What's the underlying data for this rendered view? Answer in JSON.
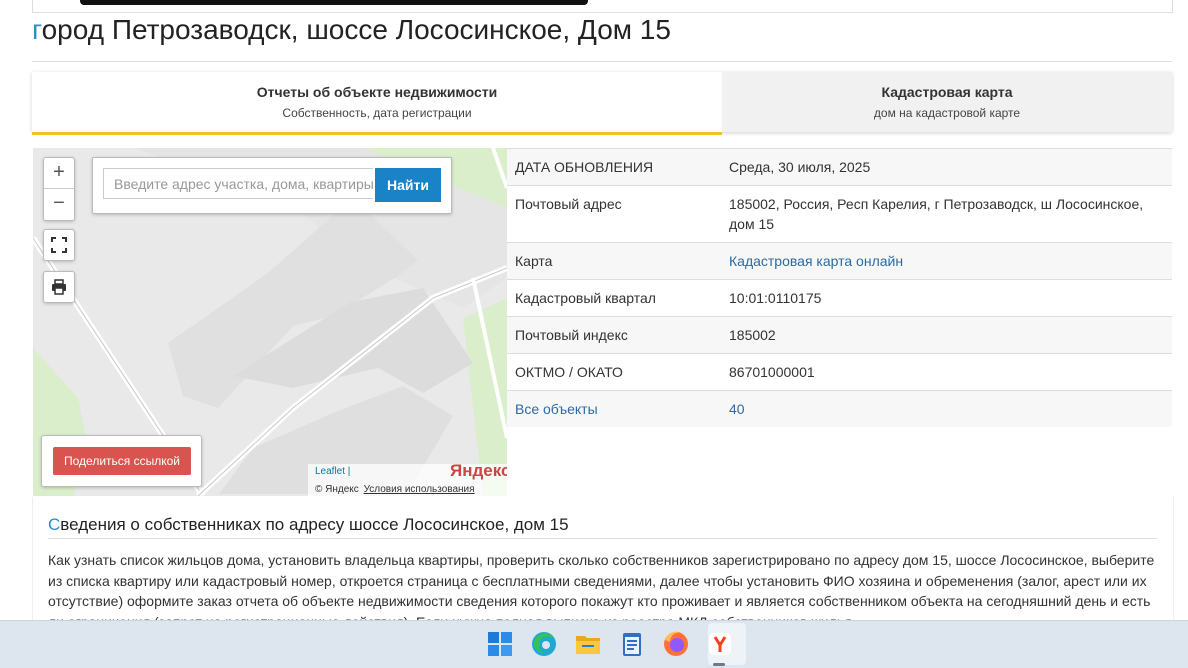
{
  "page": {
    "title_first_letter": "г",
    "title_rest": "ород Петрозаводск, шоссе Лососинское, Дом 15"
  },
  "tabs": [
    {
      "title": "Отчеты об объекте недвижимости",
      "subtitle": "Собственность, дата регистрации"
    },
    {
      "title": "Кадастровая карта",
      "subtitle": "дом на кадастровой карте"
    }
  ],
  "map": {
    "zoom_in": "+",
    "zoom_out": "−",
    "search_placeholder": "Введите адрес участка, дома, квартиры",
    "search_button": "Найти",
    "share_button": "Поделиться ссылкой",
    "attribution_leaflet": "Leaflet |",
    "attribution_yandex": "© Яндекс",
    "terms_link": "Условия использования",
    "yandex_logo": "Яндекс",
    "icons": [
      "fullscreen-icon",
      "print-icon"
    ]
  },
  "info_rows": [
    {
      "label": "ДАТА ОБНОВЛЕНИЯ",
      "value": "Среда, 30 июля, 2025"
    },
    {
      "label": "Почтовый адрес",
      "value": "185002, Россия, Респ Карелия, г Петрозаводск, ш Лососинское, дом 15"
    },
    {
      "label": "Карта",
      "value": "Кадастровая карта онлайн"
    },
    {
      "label": "Кадастровый квартал",
      "value": "10:01:0110175"
    },
    {
      "label": "Почтовый индекс",
      "value": "185002"
    },
    {
      "label": "ОКТМО / ОКАТО",
      "value": "86701000001"
    },
    {
      "label": "Все объекты",
      "value": "40"
    }
  ],
  "section": {
    "title_first_letter": "С",
    "title_rest": "ведения о собственниках по адресу шоссе Лососинское, дом 15",
    "text": "Как узнать список жильцов дома, установить владельца квартиры, проверить сколько собственников зарегистрировано по адресу дом 15, шоссе Лососинское, выберите из списка квартиру или кадастровый номер, откроется страница с бесплатными сведениями, далее чтобы установить ФИО хозяина и обременения (залог, арест или их отсутствие) оформите заказ отчета об объекте недвижимости сведения которого покажут кто проживает и является собственником объекта на сегодняшний день и есть ли ограничения (запрет на регистрационные действия). Если нужна полная выписка из реестра МКД собственников жилья"
  },
  "taskbar": {
    "icons": [
      "windows-start-icon",
      "edge-icon",
      "file-explorer-icon",
      "notepad-icon",
      "firefox-icon",
      "yandex-browser-icon"
    ]
  },
  "colors": {
    "accent": "#2a8ec9",
    "tab_underline": "#f2c12e",
    "search_button": "#1a82c7",
    "share_button": "#d9534f"
  }
}
